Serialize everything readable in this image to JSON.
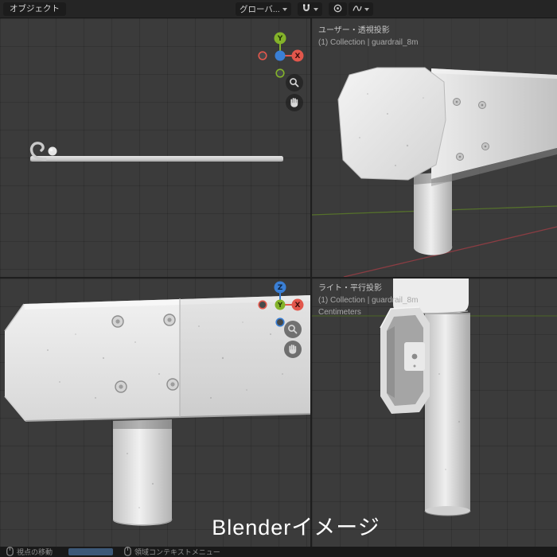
{
  "header": {
    "mode_button": "オブジェクト",
    "orientation_button": "グローバ..."
  },
  "viewports": {
    "top_right": {
      "view_mode": "ユーザー・透視投影",
      "collection": "(1) Collection | guardrail_8m"
    },
    "bottom_right": {
      "view_mode": "ライト・平行投影",
      "collection": "(1) Collection | guardrail_8m",
      "units": "Centimeters"
    }
  },
  "gizmos": {
    "x_label": "X",
    "y_label": "Y",
    "z_label": "Z"
  },
  "caption": "Blenderイメージ",
  "status_bar": {
    "view_hint": "視点の移動",
    "context_hint": "領域コンテキストメニュー"
  },
  "colors": {
    "axis_x": "#e2574c",
    "axis_y": "#84b32a",
    "axis_z": "#3a7fd5",
    "viewport_background": "#3b3b3b",
    "model_surface": "#e8e8e8"
  }
}
